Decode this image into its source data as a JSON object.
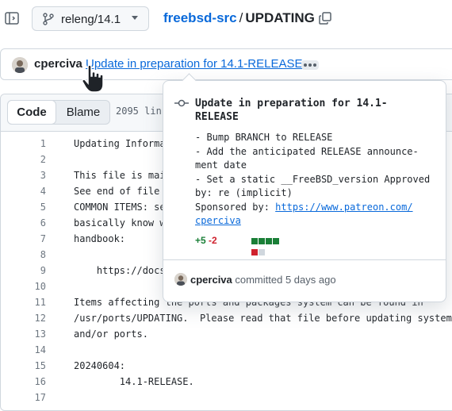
{
  "header": {
    "branch": "releng/14.1",
    "repo": "freebsd-src",
    "separator": "/",
    "file": "UPDATING"
  },
  "commit": {
    "author": "cperciva",
    "message": "Update in preparation for 14.1-RELEASE"
  },
  "toolbar": {
    "code_tab": "Code",
    "blame_tab": "Blame",
    "line_count": "2095 lin"
  },
  "lines": [
    {
      "n": "1",
      "t": "Updating Informa"
    },
    {
      "n": "2",
      "t": ""
    },
    {
      "n": "3",
      "t": "This file is mai"
    },
    {
      "n": "4",
      "t": "See end of file "
    },
    {
      "n": "5",
      "t": "COMMON ITEMS: se"
    },
    {
      "n": "6",
      "t": "basically know w"
    },
    {
      "n": "7",
      "t": "handbook:"
    },
    {
      "n": "8",
      "t": ""
    },
    {
      "n": "9",
      "t": "    https://docs"
    },
    {
      "n": "10",
      "t": ""
    },
    {
      "n": "11",
      "t": "Items affecting the ports and packages system can be found in"
    },
    {
      "n": "12",
      "t": "/usr/ports/UPDATING.  Please read that file before updating system"
    },
    {
      "n": "13",
      "t": "and/or ports."
    },
    {
      "n": "14",
      "t": ""
    },
    {
      "n": "15",
      "t": "20240604:"
    },
    {
      "n": "16",
      "t": "        14.1-RELEASE."
    },
    {
      "n": "17",
      "t": ""
    }
  ],
  "popover": {
    "title_1": "Update in preparation for 14.1-",
    "title_2": "RELEASE",
    "body_1": "- Bump BRANCH to RELEASE",
    "body_2": "- Add the anticipated RELEASE announce-",
    "body_3": "ment date",
    "body_4": "- Set a static __FreeBSD_version Approved",
    "body_5": "by: re (implicit)",
    "body_6": "Sponsored by: ",
    "link_1": "https://www.patreon.com/",
    "link_2": "cperciva",
    "additions": "+5",
    "deletions": "-2",
    "diff_blocks": [
      "add",
      "add",
      "add",
      "add",
      "del",
      "neutral"
    ],
    "footer_author": "cperciva",
    "footer_text": " committed 5 days ago"
  },
  "colors": {
    "link": "#0969da",
    "add": "#1a7f37",
    "del": "#cf222e",
    "neutral": "#d0d7de"
  }
}
